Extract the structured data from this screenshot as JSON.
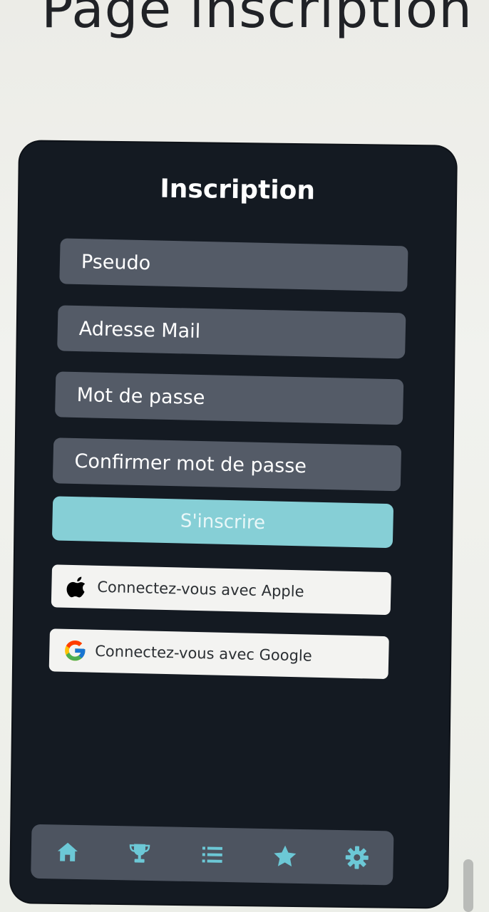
{
  "page": {
    "title": "Page inscription"
  },
  "form": {
    "title": "Inscription",
    "fields": [
      {
        "label": "Pseudo"
      },
      {
        "label": "Adresse Mail"
      },
      {
        "label": "Mot de passe"
      },
      {
        "label": "Confirmer mot de passe"
      }
    ],
    "submit_label": "S'inscrire",
    "social": {
      "apple_label": "Connectez-vous avec Apple",
      "google_label": "Connectez-vous avec Google"
    }
  },
  "nav": {
    "items": [
      {
        "icon": "home-icon"
      },
      {
        "icon": "trophy-icon"
      },
      {
        "icon": "list-icon"
      },
      {
        "icon": "star-icon"
      },
      {
        "icon": "gear-icon"
      }
    ]
  },
  "colors": {
    "phone_bg": "#141a22",
    "field_bg": "#545b67",
    "accent": "#86cfd6",
    "nav_icon": "#6cc8d6",
    "social_bg": "#f3f3f1"
  }
}
